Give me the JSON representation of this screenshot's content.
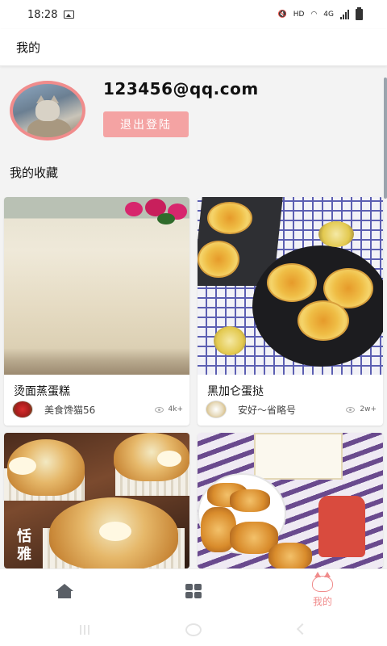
{
  "status_bar": {
    "time": "18:28",
    "hd": "HD",
    "network": "4G"
  },
  "header": {
    "title": "我的"
  },
  "profile": {
    "email": "123456@qq.com",
    "logout_label": "退出登陆"
  },
  "favorites": {
    "title": "我的收藏",
    "items": [
      {
        "title": "烫面蒸蛋糕",
        "author": "美食馋猫56",
        "views": "4k+"
      },
      {
        "title": "黑加仑蛋挞",
        "author": "安好～省略号",
        "views": "2w+"
      },
      {
        "title": "",
        "author": "",
        "views": ""
      },
      {
        "title": "",
        "author": "",
        "views": ""
      }
    ]
  },
  "card_images": {
    "cupcake_text": "恬雅"
  },
  "tab_bar": {
    "items": [
      {
        "icon": "home-icon",
        "label": ""
      },
      {
        "icon": "grid-icon",
        "label": ""
      },
      {
        "icon": "cat-icon",
        "label": "我的",
        "active": true
      }
    ]
  },
  "colors": {
    "accent": "#f08c8c",
    "button": "#f4a3a3",
    "icon_gray": "#5a5f66"
  }
}
